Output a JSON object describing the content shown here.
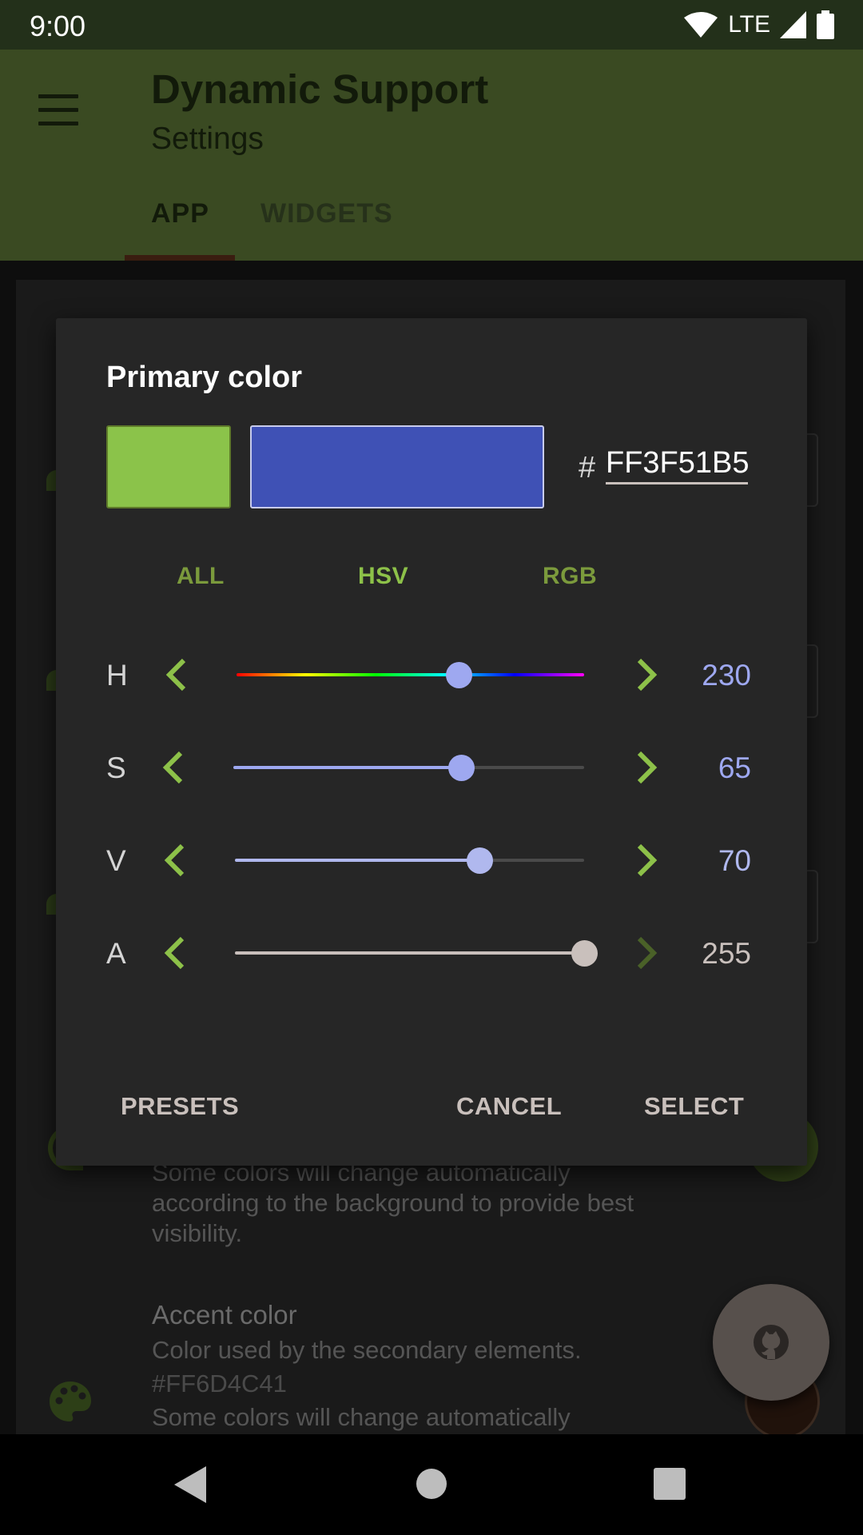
{
  "status_bar": {
    "time": "9:00",
    "network": "LTE"
  },
  "app_bar": {
    "title": "Dynamic Support",
    "subtitle": "Settings",
    "tabs": [
      "APP",
      "WIDGETS"
    ],
    "active_tab": "APP"
  },
  "background": {
    "primary_desc_lines": [
      "Some colors will change automatically",
      "according to the background to provide best",
      "visibility."
    ],
    "accent_title": "Accent color",
    "accent_desc": "Color used by the secondary elements.",
    "accent_value": "#FF6D4C41",
    "accent_more": "Some colors will change automatically"
  },
  "dialog": {
    "title": "Primary color",
    "previous_color": "#8bc34a",
    "new_color": "#3f51b5",
    "hex_prefix": "#",
    "hex_value": "FF3F51B5",
    "modes": [
      "ALL",
      "HSV",
      "RGB"
    ],
    "active_mode": "HSV",
    "sliders": {
      "h": {
        "label": "H",
        "value": "230",
        "fraction": 0.639
      },
      "s": {
        "label": "S",
        "value": "65",
        "fraction": 0.65
      },
      "v": {
        "label": "V",
        "value": "70",
        "fraction": 0.7
      },
      "a": {
        "label": "A",
        "value": "255",
        "fraction": 1.0
      }
    },
    "buttons": {
      "presets": "PRESETS",
      "cancel": "CANCEL",
      "select": "SELECT"
    }
  },
  "colors": {
    "accent_green": "#8dc149",
    "hsv_value_color": "#9ea8f0",
    "alpha_value_color": "#c9c0bc"
  },
  "icons": [
    "wifi-icon",
    "lte-signal-icon",
    "battery-icon",
    "menu-icon",
    "chevron-left-icon",
    "chevron-right-icon",
    "palette-icon",
    "github-icon",
    "back-icon",
    "home-icon",
    "recents-icon"
  ]
}
